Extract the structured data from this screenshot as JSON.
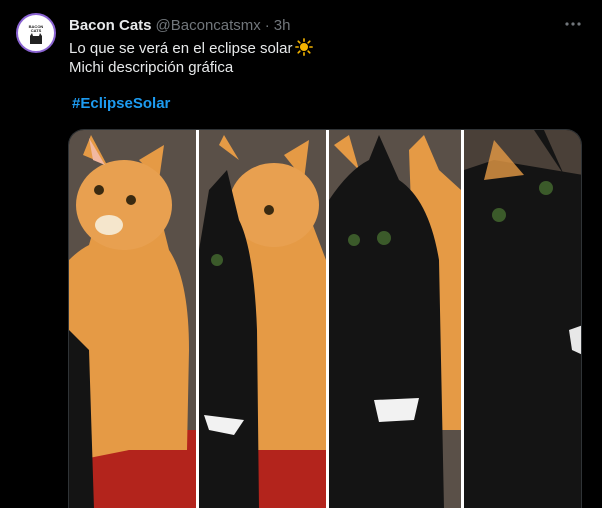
{
  "tweet": {
    "author_name": "Bacon Cats",
    "handle": "@Baconcatsmx",
    "separator": "·",
    "time": "3h",
    "line1": "Lo que se verá en el eclipse solar",
    "line2": "Michi descripción gráfica",
    "hashtag": "#EclipseSolar"
  },
  "media": {
    "description_panels": [
      "orange-cat",
      "black-cat-entering",
      "black-cat-covering",
      "black-cat-full"
    ]
  },
  "colors": {
    "background": "#000000",
    "text": "#e7e9ea",
    "muted": "#71767b",
    "link": "#1d9bf0",
    "orange_cat": "#e59a45",
    "black_cat": "#141414"
  },
  "icons": [
    "more-icon",
    "sun-emoji-icon",
    "avatar-logo-icon"
  ]
}
